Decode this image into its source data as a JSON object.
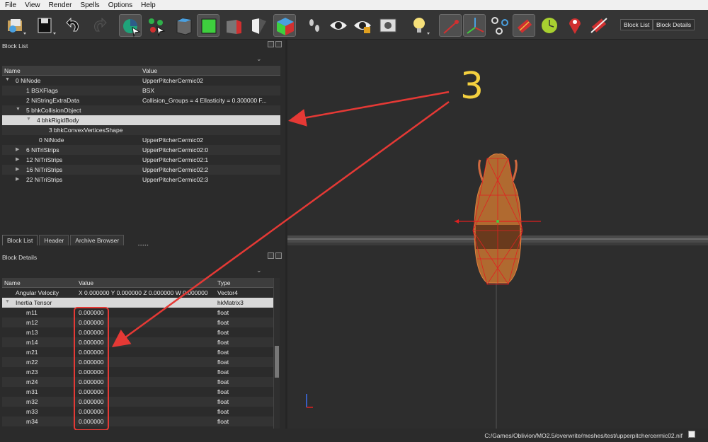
{
  "menu": [
    "File",
    "View",
    "Render",
    "Spells",
    "Options",
    "Help"
  ],
  "toolbar": {
    "block_list_button": "Block List",
    "block_details_button": "Block Details"
  },
  "block_list": {
    "title": "Block List",
    "col_name": "Name",
    "col_value": "Value",
    "rows": [
      {
        "name": "0 NiNode",
        "value": "UpperPitcherCermic02"
      },
      {
        "name": "1 BSXFlags",
        "value": "BSX"
      },
      {
        "name": "2 NiStringExtraData",
        "value": "Collision_Groups = 4  Ellasticity = 0.300000  F..."
      },
      {
        "name": "5 bhkCollisionObject",
        "value": ""
      },
      {
        "name": "4 bhkRigidBody",
        "value": ""
      },
      {
        "name": "3 bhkConvexVerticesShape",
        "value": ""
      },
      {
        "name": "0 NiNode",
        "value": "UpperPitcherCermic02"
      },
      {
        "name": "6 NiTriStrips",
        "value": "UpperPitcherCermic02:0"
      },
      {
        "name": "12 NiTriStrips",
        "value": "UpperPitcherCermic02:1"
      },
      {
        "name": "16 NiTriStrips",
        "value": "UpperPitcherCermic02:2"
      },
      {
        "name": "22 NiTriStrips",
        "value": "UpperPitcherCermic02:3"
      }
    ]
  },
  "tabs": [
    "Block List",
    "Header",
    "Archive Browser"
  ],
  "block_details": {
    "title": "Block Details",
    "col_name": "Name",
    "col_value": "Value",
    "col_type": "Type",
    "rows": [
      {
        "name": "Angular Velocity",
        "value": "X 0.000000 Y 0.000000 Z 0.000000 W 0.000000",
        "type": "Vector4"
      },
      {
        "name": "Inertia Tensor",
        "value": "",
        "type": "hkMatrix3"
      },
      {
        "name": "m11",
        "value": "0.000000",
        "type": "float"
      },
      {
        "name": "m12",
        "value": "0.000000",
        "type": "float"
      },
      {
        "name": "m13",
        "value": "0.000000",
        "type": "float"
      },
      {
        "name": "m14",
        "value": "0.000000",
        "type": "float"
      },
      {
        "name": "m21",
        "value": "0.000000",
        "type": "float"
      },
      {
        "name": "m22",
        "value": "0.000000",
        "type": "float"
      },
      {
        "name": "m23",
        "value": "0.000000",
        "type": "float"
      },
      {
        "name": "m24",
        "value": "0.000000",
        "type": "float"
      },
      {
        "name": "m31",
        "value": "0.000000",
        "type": "float"
      },
      {
        "name": "m32",
        "value": "0.000000",
        "type": "float"
      },
      {
        "name": "m33",
        "value": "0.000000",
        "type": "float"
      },
      {
        "name": "m34",
        "value": "0.000000",
        "type": "float"
      }
    ]
  },
  "annotation": {
    "number": "3",
    "color": "#e53935",
    "number_color": "#f4d03f"
  },
  "status": {
    "path": "C:/Games/Oblivion/MO2.5/overwrite/meshes/test/upperpitchercermic02.nif"
  }
}
